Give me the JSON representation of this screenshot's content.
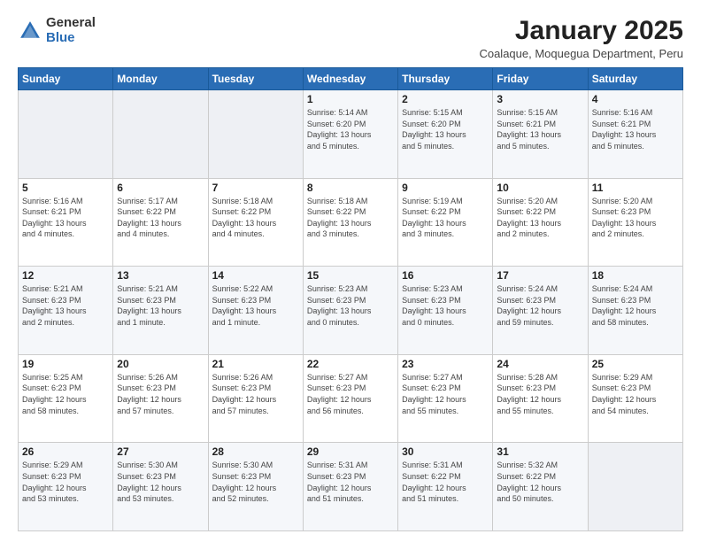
{
  "header": {
    "logo_general": "General",
    "logo_blue": "Blue",
    "month_title": "January 2025",
    "subtitle": "Coalaque, Moquegua Department, Peru"
  },
  "weekdays": [
    "Sunday",
    "Monday",
    "Tuesday",
    "Wednesday",
    "Thursday",
    "Friday",
    "Saturday"
  ],
  "weeks": [
    [
      {
        "num": "",
        "info": ""
      },
      {
        "num": "",
        "info": ""
      },
      {
        "num": "",
        "info": ""
      },
      {
        "num": "1",
        "info": "Sunrise: 5:14 AM\nSunset: 6:20 PM\nDaylight: 13 hours\nand 5 minutes."
      },
      {
        "num": "2",
        "info": "Sunrise: 5:15 AM\nSunset: 6:20 PM\nDaylight: 13 hours\nand 5 minutes."
      },
      {
        "num": "3",
        "info": "Sunrise: 5:15 AM\nSunset: 6:21 PM\nDaylight: 13 hours\nand 5 minutes."
      },
      {
        "num": "4",
        "info": "Sunrise: 5:16 AM\nSunset: 6:21 PM\nDaylight: 13 hours\nand 5 minutes."
      }
    ],
    [
      {
        "num": "5",
        "info": "Sunrise: 5:16 AM\nSunset: 6:21 PM\nDaylight: 13 hours\nand 4 minutes."
      },
      {
        "num": "6",
        "info": "Sunrise: 5:17 AM\nSunset: 6:22 PM\nDaylight: 13 hours\nand 4 minutes."
      },
      {
        "num": "7",
        "info": "Sunrise: 5:18 AM\nSunset: 6:22 PM\nDaylight: 13 hours\nand 4 minutes."
      },
      {
        "num": "8",
        "info": "Sunrise: 5:18 AM\nSunset: 6:22 PM\nDaylight: 13 hours\nand 3 minutes."
      },
      {
        "num": "9",
        "info": "Sunrise: 5:19 AM\nSunset: 6:22 PM\nDaylight: 13 hours\nand 3 minutes."
      },
      {
        "num": "10",
        "info": "Sunrise: 5:20 AM\nSunset: 6:22 PM\nDaylight: 13 hours\nand 2 minutes."
      },
      {
        "num": "11",
        "info": "Sunrise: 5:20 AM\nSunset: 6:23 PM\nDaylight: 13 hours\nand 2 minutes."
      }
    ],
    [
      {
        "num": "12",
        "info": "Sunrise: 5:21 AM\nSunset: 6:23 PM\nDaylight: 13 hours\nand 2 minutes."
      },
      {
        "num": "13",
        "info": "Sunrise: 5:21 AM\nSunset: 6:23 PM\nDaylight: 13 hours\nand 1 minute."
      },
      {
        "num": "14",
        "info": "Sunrise: 5:22 AM\nSunset: 6:23 PM\nDaylight: 13 hours\nand 1 minute."
      },
      {
        "num": "15",
        "info": "Sunrise: 5:23 AM\nSunset: 6:23 PM\nDaylight: 13 hours\nand 0 minutes."
      },
      {
        "num": "16",
        "info": "Sunrise: 5:23 AM\nSunset: 6:23 PM\nDaylight: 13 hours\nand 0 minutes."
      },
      {
        "num": "17",
        "info": "Sunrise: 5:24 AM\nSunset: 6:23 PM\nDaylight: 12 hours\nand 59 minutes."
      },
      {
        "num": "18",
        "info": "Sunrise: 5:24 AM\nSunset: 6:23 PM\nDaylight: 12 hours\nand 58 minutes."
      }
    ],
    [
      {
        "num": "19",
        "info": "Sunrise: 5:25 AM\nSunset: 6:23 PM\nDaylight: 12 hours\nand 58 minutes."
      },
      {
        "num": "20",
        "info": "Sunrise: 5:26 AM\nSunset: 6:23 PM\nDaylight: 12 hours\nand 57 minutes."
      },
      {
        "num": "21",
        "info": "Sunrise: 5:26 AM\nSunset: 6:23 PM\nDaylight: 12 hours\nand 57 minutes."
      },
      {
        "num": "22",
        "info": "Sunrise: 5:27 AM\nSunset: 6:23 PM\nDaylight: 12 hours\nand 56 minutes."
      },
      {
        "num": "23",
        "info": "Sunrise: 5:27 AM\nSunset: 6:23 PM\nDaylight: 12 hours\nand 55 minutes."
      },
      {
        "num": "24",
        "info": "Sunrise: 5:28 AM\nSunset: 6:23 PM\nDaylight: 12 hours\nand 55 minutes."
      },
      {
        "num": "25",
        "info": "Sunrise: 5:29 AM\nSunset: 6:23 PM\nDaylight: 12 hours\nand 54 minutes."
      }
    ],
    [
      {
        "num": "26",
        "info": "Sunrise: 5:29 AM\nSunset: 6:23 PM\nDaylight: 12 hours\nand 53 minutes."
      },
      {
        "num": "27",
        "info": "Sunrise: 5:30 AM\nSunset: 6:23 PM\nDaylight: 12 hours\nand 53 minutes."
      },
      {
        "num": "28",
        "info": "Sunrise: 5:30 AM\nSunset: 6:23 PM\nDaylight: 12 hours\nand 52 minutes."
      },
      {
        "num": "29",
        "info": "Sunrise: 5:31 AM\nSunset: 6:23 PM\nDaylight: 12 hours\nand 51 minutes."
      },
      {
        "num": "30",
        "info": "Sunrise: 5:31 AM\nSunset: 6:22 PM\nDaylight: 12 hours\nand 51 minutes."
      },
      {
        "num": "31",
        "info": "Sunrise: 5:32 AM\nSunset: 6:22 PM\nDaylight: 12 hours\nand 50 minutes."
      },
      {
        "num": "",
        "info": ""
      }
    ]
  ]
}
